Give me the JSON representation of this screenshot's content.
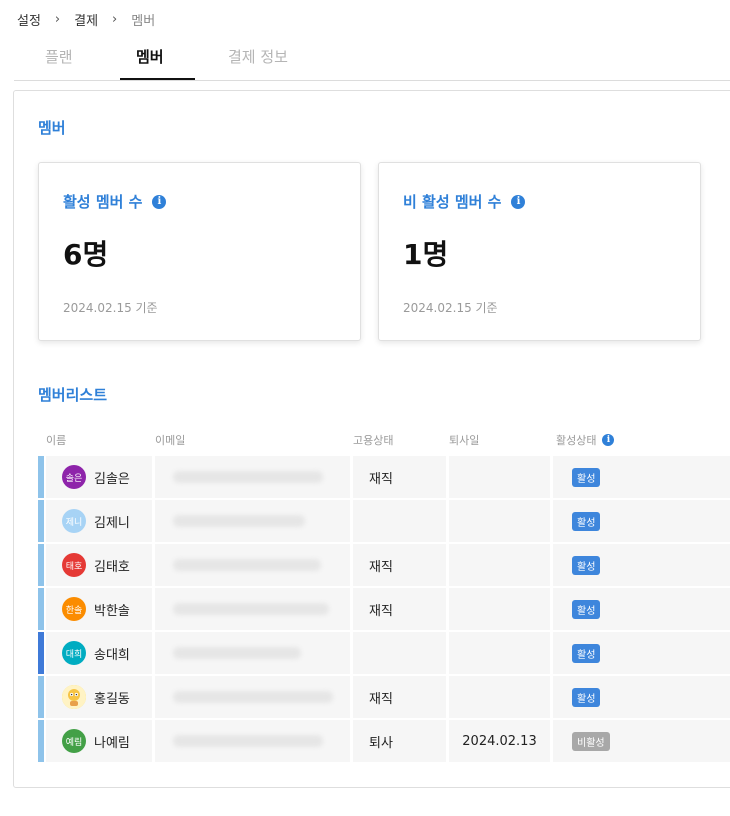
{
  "breadcrumb": {
    "items": [
      "설정",
      "결제",
      "멤버"
    ],
    "separator": "›"
  },
  "tabs": [
    {
      "label": "플랜",
      "active": false
    },
    {
      "label": "멤버",
      "active": true
    },
    {
      "label": "결제 정보",
      "active": false
    }
  ],
  "section_title": "멤버",
  "cards": {
    "active": {
      "title": "활성 멤버 수",
      "value": "6명",
      "date": "2024.02.15 기준"
    },
    "inactive": {
      "title": "비 활성 멤버 수",
      "value": "1명",
      "date": "2024.02.15 기준"
    }
  },
  "info_glyph": "i",
  "list_title": "멤버리스트",
  "table": {
    "headers": {
      "name": "이름",
      "email": "이메일",
      "status": "고용상태",
      "leave": "퇴사일",
      "active": "활성상태"
    }
  },
  "members": [
    {
      "avatar_text": "솔은",
      "avatar_color": "#8e24aa",
      "name": "김솔은",
      "employment": "재직",
      "leave_date": "",
      "state": "활성",
      "is_active": true
    },
    {
      "avatar_text": "제니",
      "avatar_color": "#a7d3f5",
      "name": "김제니",
      "employment": "",
      "leave_date": "",
      "state": "활성",
      "is_active": true
    },
    {
      "avatar_text": "태호",
      "avatar_color": "#e53935",
      "name": "김태호",
      "employment": "재직",
      "leave_date": "",
      "state": "활성",
      "is_active": true
    },
    {
      "avatar_text": "한솔",
      "avatar_color": "#fb8c00",
      "name": "박한솔",
      "employment": "재직",
      "leave_date": "",
      "state": "활성",
      "is_active": true
    },
    {
      "avatar_text": "대희",
      "avatar_color": "#00acc1",
      "name": "송대희",
      "employment": "",
      "leave_date": "",
      "state": "활성",
      "is_active": true
    },
    {
      "avatar_text": "",
      "avatar_icon": "character-avatar-icon",
      "avatar_color": "#fdd835",
      "name": "홍길동",
      "employment": "재직",
      "leave_date": "",
      "state": "활성",
      "is_active": true
    },
    {
      "avatar_text": "예림",
      "avatar_color": "#43a047",
      "name": "나예림",
      "employment": "퇴사",
      "leave_date": "2024.02.13",
      "state": "비활성",
      "is_active": false
    }
  ],
  "colors": {
    "accent": "#2f80d8",
    "row_bar": "#8ec3ea",
    "row_bar_selected": "#3f7ad8",
    "badge_active": "#3e86dc",
    "badge_inactive": "#a8a8a8"
  }
}
